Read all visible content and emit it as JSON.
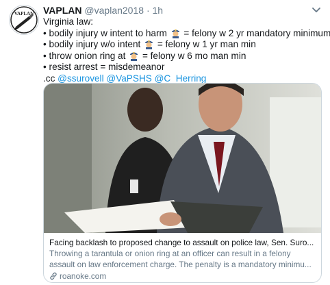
{
  "tweet": {
    "author_name": "VAPLAN",
    "handle": "@vaplan2018",
    "separator": "·",
    "time": "1h",
    "avatar_text": "VAPLAN",
    "lines": [
      {
        "text": "Virginia law:"
      },
      {
        "before": "• bodily injury w intent to harm",
        "emoji": "police-officer",
        "after": "= felony w 2 yr mandatory minimum"
      },
      {
        "before": "• bodily injury w/o intent",
        "emoji": "police-officer",
        "after": "= felony w 1 yr man min"
      },
      {
        "before": "• throw onion ring at",
        "emoji": "police-officer",
        "after": "= felony w 6 mo man min"
      },
      {
        "text": "• resist arrest = misdemeanor"
      }
    ],
    "cc_prefix": ".cc",
    "mentions": [
      "@ssurovell",
      "@VaPSHS",
      "@C_Herring"
    ]
  },
  "card": {
    "title": "Facing backlash to proposed change to assault on police law, Sen. Suro...",
    "desc_line1": "Throwing a tarantula or onion ring at an officer can result in a felony",
    "desc_line2": "assault on law enforcement charge. The penalty is a mandatory minimu...",
    "domain": "roanoke.com"
  },
  "colors": {
    "accent": "#1b95e0",
    "text": "#14171a",
    "secondary": "#657786",
    "border": "#ccd6dd"
  }
}
